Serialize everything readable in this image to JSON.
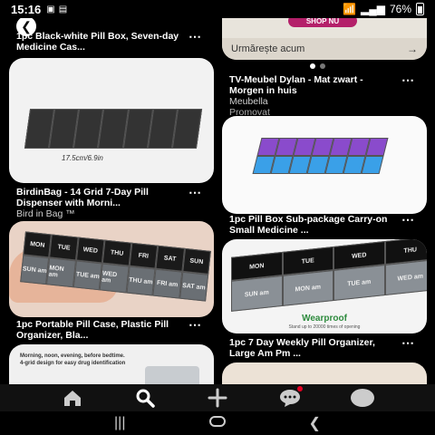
{
  "status": {
    "time": "15:16",
    "battery": "76%"
  },
  "cards": {
    "c1": {
      "title": "1pc Black-white Pill Box, Seven-day Medicine Cas..."
    },
    "c2": {
      "button": "SHOP NU",
      "cta": "Urmărește acum"
    },
    "c3": {
      "dimension": "17.5cm/6.9in",
      "title": "BirdinBag - 14 Grid 7-Day Pill Dispenser with Morni...",
      "source": "Bird in Bag ™"
    },
    "c4": {
      "title": "TV-Meubel Dylan - Mat zwart - Morgen in huis",
      "source": "Meubella",
      "promoted": "Promovat"
    },
    "c5": {
      "title": "1pc Pill Box Sub-package Carry-on Small Medicine ..."
    },
    "c6": {
      "title": "1pc Portable Pill Case, Plastic Pill Organizer, Bla..."
    },
    "c7": {
      "badge": "Wearproof",
      "badge_sub": "Stand up to 20000 times of opening",
      "title": "1pc 7 Day Weekly Pill Organizer, Large Am Pm ..."
    },
    "c8": {
      "line1": "Morning, noon, evening, before bedtime.",
      "line2": "4-grid design for easy drug identification"
    }
  },
  "pill_labels": {
    "top": [
      "MON",
      "TUE",
      "WED",
      "THU",
      "FRI",
      "SAT",
      "SUN"
    ],
    "rows_c6": [
      "SUN am",
      "MON am",
      "TUE am",
      "WED am",
      "THU am",
      "FRI am",
      "SAT am"
    ],
    "rows_c7": [
      "SUN am",
      "MON am",
      "TUE am",
      "WED am"
    ]
  },
  "icons": {
    "status": [
      "gallery-icon",
      "image-icon",
      "wifi-icon",
      "signal-icon",
      "battery-icon"
    ],
    "nav": [
      "home-icon",
      "search-icon",
      "plus-icon",
      "messages-icon",
      "profile-icon"
    ],
    "sys": [
      "recent-apps-icon",
      "home-button-icon",
      "back-icon"
    ]
  },
  "colors": {
    "accent": "#e60023",
    "green": "#2e8b3e",
    "purple": "#8a4bcc",
    "blue": "#3aa0e8"
  }
}
